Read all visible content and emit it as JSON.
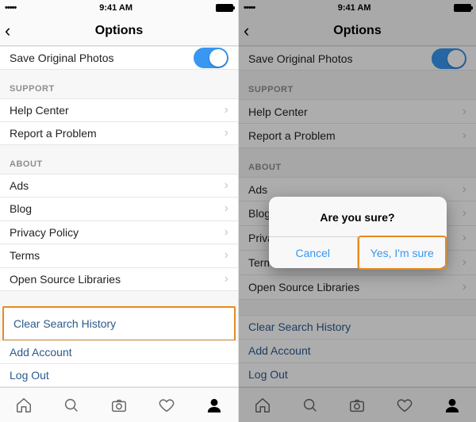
{
  "statusbar": {
    "signal": "•••••",
    "time": "9:41 AM"
  },
  "nav": {
    "title": "Options"
  },
  "rows": {
    "save_photos": "Save Original Photos",
    "support_header": "SUPPORT",
    "help_center": "Help Center",
    "report_problem": "Report a Problem",
    "about_header": "ABOUT",
    "ads": "Ads",
    "blog": "Blog",
    "privacy": "Privacy Policy",
    "privacy_truncated": "Privacy",
    "terms": "Terms",
    "oss": "Open Source Libraries",
    "clear_search": "Clear Search History",
    "add_account": "Add Account",
    "log_out": "Log Out"
  },
  "alert": {
    "title": "Are you sure?",
    "cancel": "Cancel",
    "confirm": "Yes, I'm sure"
  },
  "highlight_color": "#e78b1f",
  "accent_color": "#3897f0"
}
